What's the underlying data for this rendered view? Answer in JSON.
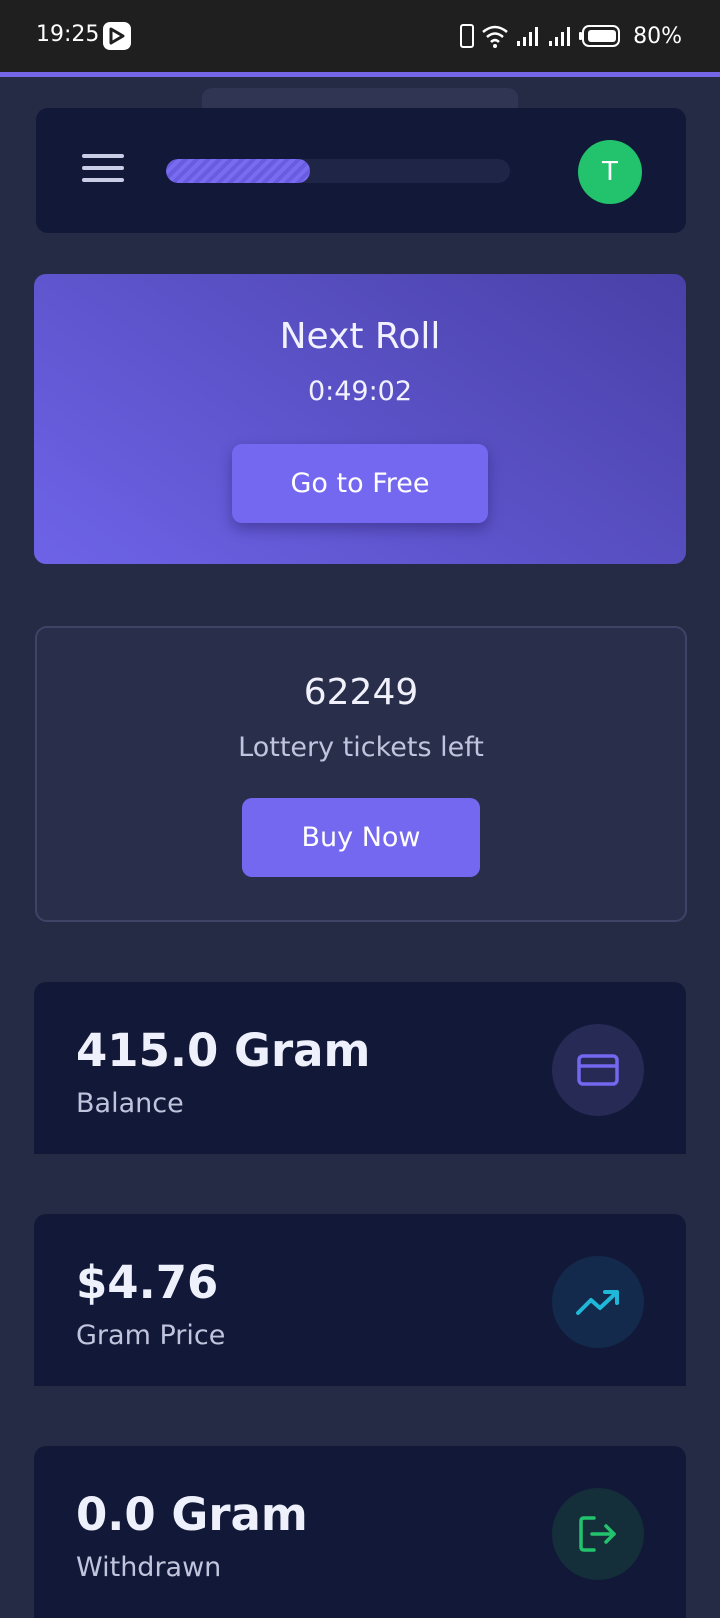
{
  "status_bar": {
    "time": "19:25",
    "battery": "80%"
  },
  "header": {
    "avatar_initial": "T",
    "progress_fraction": 0.42
  },
  "roll": {
    "title": "Next Roll",
    "timer": "0:49:02",
    "button_label": "Go to Free"
  },
  "lottery": {
    "count": "62249",
    "label": "Lottery tickets left",
    "button_label": "Buy Now"
  },
  "stats": [
    {
      "value": "415.0 Gram",
      "label": "Balance",
      "icon": "card-icon",
      "icon_color": "#7468f0"
    },
    {
      "value": "$4.76",
      "label": "Gram Price",
      "icon": "trending-up-icon",
      "icon_color": "#1fb8d8"
    },
    {
      "value": "0.0 Gram",
      "label": "Withdrawn",
      "icon": "logout-icon",
      "icon_color": "#22c36c"
    }
  ],
  "colors": {
    "accent": "#7468f0",
    "background": "#262b45",
    "card": "#121837"
  }
}
